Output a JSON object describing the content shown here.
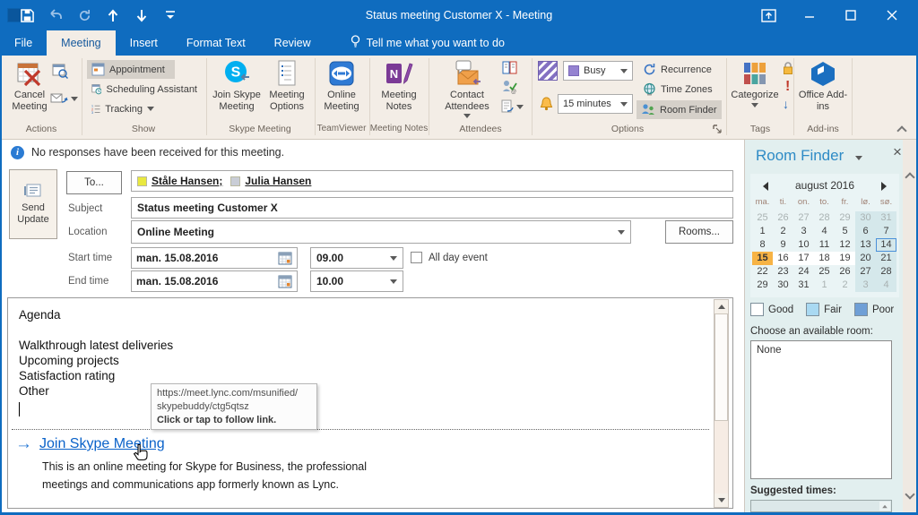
{
  "app": {
    "title": "Status meeting Customer X - Meeting"
  },
  "colors": {
    "titlebar": "#0f6cbf",
    "ribbon_bg": "#f3ede6",
    "link_blue": "#0a62c9",
    "selected_day": "#f7b345",
    "room_finder_title": "#2e8bc6"
  },
  "qat_icons": [
    "save",
    "undo",
    "redo",
    "move-up",
    "move-down",
    "customize-quick-access-toolbar"
  ],
  "window_controls": [
    "ribbon-display-options",
    "minimize",
    "maximize",
    "close"
  ],
  "tabs": [
    "File",
    "Meeting",
    "Insert",
    "Format Text",
    "Review"
  ],
  "tellme": "Tell me what you want to do",
  "ribbon": {
    "actions": {
      "group": "Actions",
      "cancel": "Cancel Meeting"
    },
    "show": {
      "group": "Show",
      "appointment": "Appointment",
      "scheduling": "Scheduling Assistant",
      "tracking": "Tracking"
    },
    "skype": {
      "group": "Skype Meeting",
      "join": "Join Skype Meeting",
      "options": "Meeting Options"
    },
    "teamviewer": {
      "group": "TeamViewer",
      "online": "Online Meeting"
    },
    "notes": {
      "group": "Meeting Notes",
      "button": "Meeting Notes"
    },
    "attendees": {
      "group": "Attendees",
      "contact": "Contact Attendees"
    },
    "options": {
      "group": "Options",
      "show_as": "Busy",
      "reminder": "15 minutes",
      "recurrence": "Recurrence",
      "time_zones": "Time Zones",
      "room_finder": "Room Finder"
    },
    "tags": {
      "group": "Tags",
      "categorize": "Categorize"
    },
    "addins": {
      "group": "Add-ins",
      "office": "Office Add-ins"
    }
  },
  "infobar": "No responses have been received for this meeting.",
  "form": {
    "send_update": "Send Update",
    "to_button": "To...",
    "labels": {
      "subject": "Subject",
      "location": "Location",
      "start": "Start time",
      "end": "End time"
    },
    "recipients": [
      {
        "name": "Ståle Hansen;",
        "presence": "#e9e83f"
      },
      {
        "name": "Julia Hansen",
        "presence": "#c9cdd6"
      }
    ],
    "subject": "Status meeting Customer X",
    "location": "Online Meeting",
    "rooms_button": "Rooms...",
    "start_date": "man. 15.08.2016",
    "start_time": "09.00",
    "end_date": "man. 15.08.2016",
    "end_time": "10.00",
    "all_day": "All day event"
  },
  "body": {
    "lines": [
      "Agenda",
      "",
      "Walkthrough latest deliveries",
      "Upcoming projects",
      "Satisfaction rating",
      "Other"
    ],
    "link": "Join Skype Meeting",
    "description": [
      "This is an online meeting for Skype for Business, the professional",
      "meetings and communications app formerly known as Lync."
    ]
  },
  "tooltip": {
    "url_line1": "https://meet.lync.com/msunified/",
    "url_line2": "skypebuddy/ctg5qtsz",
    "hint": "Click or tap to follow link."
  },
  "room_finder": {
    "title": "Room Finder",
    "month": "august 2016",
    "day_headers": [
      "ma.",
      "ti.",
      "on.",
      "to.",
      "fr.",
      "lø.",
      "sø."
    ],
    "weeks": [
      [
        {
          "d": 25,
          "s": "m"
        },
        {
          "d": 26,
          "s": "m"
        },
        {
          "d": 27,
          "s": "m"
        },
        {
          "d": 28,
          "s": "m"
        },
        {
          "d": 29,
          "s": "m"
        },
        {
          "d": 30,
          "s": "m"
        },
        {
          "d": 31,
          "s": "m"
        }
      ],
      [
        {
          "d": 1
        },
        {
          "d": 2
        },
        {
          "d": 3
        },
        {
          "d": 4
        },
        {
          "d": 5
        },
        {
          "d": 6
        },
        {
          "d": 7
        }
      ],
      [
        {
          "d": 8
        },
        {
          "d": 9
        },
        {
          "d": 10
        },
        {
          "d": 11
        },
        {
          "d": 12
        },
        {
          "d": 13
        },
        {
          "d": 14,
          "s": "today"
        }
      ],
      [
        {
          "d": 15,
          "s": "sel"
        },
        {
          "d": 16,
          "s": "cw"
        },
        {
          "d": 17,
          "s": "cw"
        },
        {
          "d": 18,
          "s": "cw"
        },
        {
          "d": 19,
          "s": "cw"
        },
        {
          "d": 20,
          "s": "cw"
        },
        {
          "d": 21,
          "s": "cw"
        }
      ],
      [
        {
          "d": 22
        },
        {
          "d": 23
        },
        {
          "d": 24
        },
        {
          "d": 25
        },
        {
          "d": 26
        },
        {
          "d": 27
        },
        {
          "d": 28
        }
      ],
      [
        {
          "d": 29
        },
        {
          "d": 30
        },
        {
          "d": 31
        },
        {
          "d": 1,
          "s": "m"
        },
        {
          "d": 2,
          "s": "m"
        },
        {
          "d": 3,
          "s": "m"
        },
        {
          "d": 4,
          "s": "m"
        }
      ]
    ],
    "selected_day_color": "#f7b345",
    "legend": [
      {
        "label": "Good",
        "color": "#ffffff"
      },
      {
        "label": "Fair",
        "color": "#a9d9f2"
      },
      {
        "label": "Poor",
        "color": "#6f9fd6"
      }
    ],
    "choose_label": "Choose an available room:",
    "rooms": [
      "None"
    ],
    "suggested_label": "Suggested times:"
  }
}
